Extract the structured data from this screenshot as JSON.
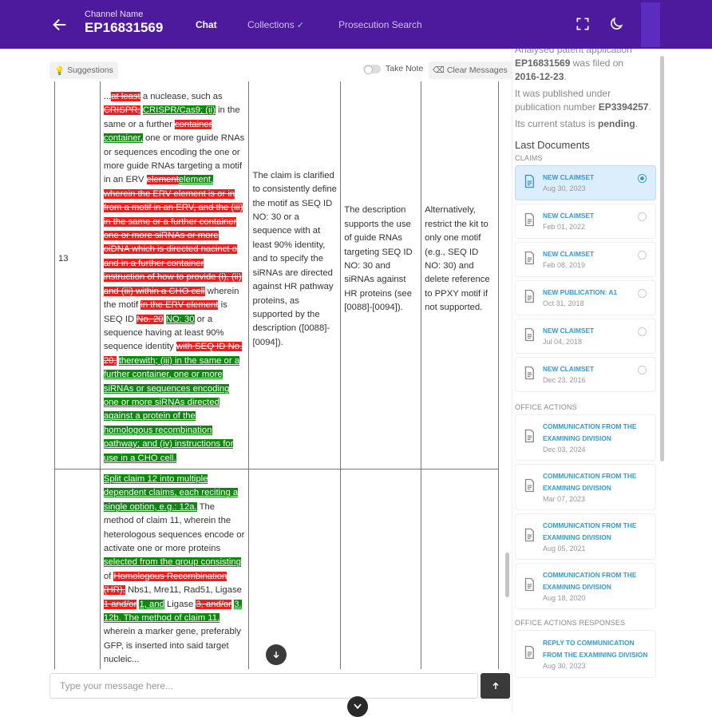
{
  "header": {
    "channel_label": "Channel Name",
    "channel_value": "EP16831569",
    "tabs": [
      {
        "label": "Chat",
        "active": true
      },
      {
        "label": "Collections",
        "active": false
      },
      {
        "label": "Prosecution Search",
        "active": false
      }
    ],
    "colors": {
      "bar": "#4d1a9e"
    }
  },
  "toolbar": {
    "suggestions_label": "Suggestions",
    "take_note_label": "Take Note",
    "clear_label": "Clear Messages"
  },
  "table": {
    "row13": {
      "num": "13",
      "claim_parts": [
        {
          "t": "n",
          "s": "..."
        },
        {
          "t": "d",
          "s": "at least"
        },
        {
          "t": "n",
          "s": " a nuclease, such as "
        },
        {
          "t": "d",
          "s": "CRISPR;"
        },
        {
          "t": "n",
          "s": " "
        },
        {
          "t": "i",
          "s": "CRISPR/Cas9; (ii)"
        },
        {
          "t": "n",
          "s": " in the same or a further "
        },
        {
          "t": "d",
          "s": "container"
        },
        {
          "t": "n",
          "s": " "
        },
        {
          "t": "i",
          "s": "container,"
        },
        {
          "t": "n",
          "s": " one or more guide RNAs or sequences encoding the one or more guide RNAs targeting a motif in an ERV "
        },
        {
          "t": "d",
          "s": "element"
        },
        {
          "t": "i",
          "s": "element,"
        },
        {
          "t": "n",
          "s": " "
        },
        {
          "t": "d",
          "s": "wherein the ERV element is or in from a motif in an ERV, and the (iii) in the same or a further container one or more siRNAs or more oiDNA which is directed nacinct o and in a further container instruction of how to provide (i), (ii) and (iii) within a CHO cell"
        },
        {
          "t": "n",
          "s": " wherein the motif "
        },
        {
          "t": "d",
          "s": "in the ERV element"
        },
        {
          "t": "n",
          "s": " is SEQ ID "
        },
        {
          "t": "d",
          "s": "No. 20"
        },
        {
          "t": "n",
          "s": " "
        },
        {
          "t": "i",
          "s": "NO: 30"
        },
        {
          "t": "n",
          "s": " or a sequence having at least 90% sequence identity "
        },
        {
          "t": "d",
          "s": "with SEQ ID No. 20;"
        },
        {
          "t": "n",
          "s": " "
        },
        {
          "t": "i",
          "s": "therewith; (iii) in the same or a further container, one or more siRNAs or sequences encoding one or more siRNAs directed against a protein of the homologous recombination pathway; and (iv) instructions for use in a CHO cell."
        }
      ],
      "col3": "The claim is clarified to consistently define the motif as SEQ ID NO: 30 or a sequence with at least 90% identity, and to specify the siRNAs are directed against HR pathway proteins, as supported by the description ([0088]-[0094]).",
      "col4": "The description supports the use of guide RNAs targeting SEQ ID NO: 30 and siRNAs against HR proteins (see [0088]-[0094]).",
      "col5": "Alternatively, restrict the kit to only one motif (e.g., SEQ ID NO: 30) and delete reference to PPXY motif if not supported."
    },
    "row14": {
      "claim_parts": [
        {
          "t": "i",
          "s": "Split claim 12 into multiple dependent claims, each reciting a single option, e.g.: 12a."
        },
        {
          "t": "n",
          "s": " The method of claim 11, wherein the heterologous sequences encode or activate one or more proteins "
        },
        {
          "t": "i",
          "s": "selected from the group consisting"
        },
        {
          "t": "n",
          "s": " of "
        },
        {
          "t": "d",
          "s": "Homologous Recombination (HR),"
        },
        {
          "t": "n",
          "s": " Nbs1, Mre11, Rad51, Ligase "
        },
        {
          "t": "d",
          "s": "1 and/or"
        },
        {
          "t": "n",
          "s": " "
        },
        {
          "t": "i",
          "s": "1, and"
        },
        {
          "t": "n",
          "s": " Ligase "
        },
        {
          "t": "d",
          "s": "3, and/or"
        },
        {
          "t": "n",
          "s": " "
        },
        {
          "t": "i",
          "s": "3. 12b. The method of claim 11,"
        },
        {
          "t": "n",
          "s": " wherein a marker gene, preferably GFP, is inserted into said target nucleic..."
        }
      ]
    }
  },
  "input": {
    "placeholder": "Type your message here..."
  },
  "sidebar": {
    "info_lines": [
      {
        "pre": "Analysed patent application ",
        "b": "",
        "post": ""
      },
      {
        "pre": "",
        "b": "EP16831569",
        "post": " was filed on "
      },
      {
        "pre": "",
        "b": "2016-12-23",
        "post": "."
      },
      {
        "pre": "It was published under publication number ",
        "b": "EP3394257",
        "post": "."
      },
      {
        "pre": "Its current status is ",
        "b": "pending",
        "post": "."
      }
    ],
    "last_docs_title": "Last Documents",
    "claims_label": "CLAIMS",
    "claims": [
      {
        "title": "NEW CLAIMSET",
        "date": "Aug 30, 2023",
        "selected": true
      },
      {
        "title": "NEW CLAIMSET",
        "date": "Feb 01, 2022",
        "selected": false
      },
      {
        "title": "NEW CLAIMSET",
        "date": "Feb 08, 2019",
        "selected": false
      },
      {
        "title": "NEW PUBLICATION: A1",
        "date": "Oct 31, 2018",
        "selected": false
      },
      {
        "title": "NEW CLAIMSET",
        "date": "Jul 04, 2018",
        "selected": false
      },
      {
        "title": "NEW CLAIMSET",
        "date": "Dec 23, 2016",
        "selected": false
      }
    ],
    "office_actions_label": "OFFICE ACTIONS",
    "office_actions": [
      {
        "title": "COMMUNICATION FROM THE EXAMINING DIVISION",
        "date": "Dec 03, 2024"
      },
      {
        "title": "COMMUNICATION FROM THE EXAMINING DIVISION",
        "date": "Mar 07, 2023"
      },
      {
        "title": "COMMUNICATION FROM THE EXAMINING DIVISION",
        "date": "Aug 05, 2021"
      },
      {
        "title": "COMMUNICATION FROM THE EXAMINING DIVISION",
        "date": "Aug 18, 2020"
      }
    ],
    "responses_label": "OFFICE ACTIONS RESPONSES",
    "responses": [
      {
        "title": "REPLY TO COMMUNICATION FROM THE EXAMINING DIVISION",
        "date": "Aug 30, 2023"
      }
    ],
    "accent_color": "#2e9bd6"
  }
}
